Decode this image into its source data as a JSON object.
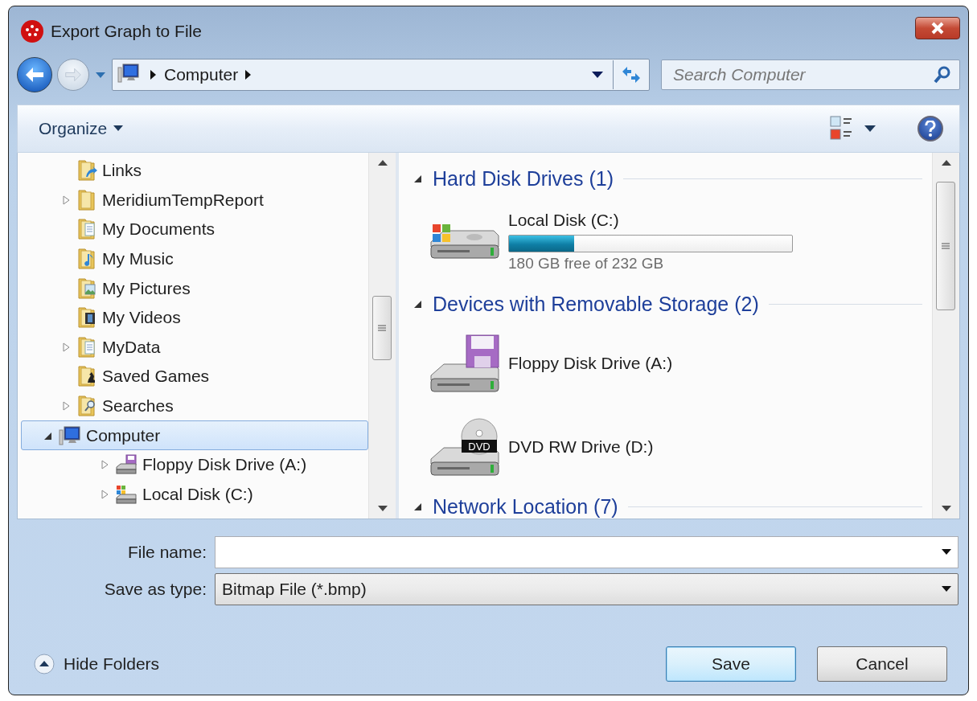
{
  "window": {
    "title": "Export Graph to File"
  },
  "address": {
    "crumbs": [
      "Computer"
    ]
  },
  "search": {
    "placeholder": "Search Computer"
  },
  "toolbar": {
    "organize": "Organize"
  },
  "tree": [
    {
      "kind": "links",
      "label": "Links",
      "has_children": false,
      "selected": false
    },
    {
      "kind": "folder",
      "label": "MeridiumTempReport",
      "has_children": true,
      "expanded": false,
      "selected": false
    },
    {
      "kind": "documents",
      "label": "My Documents",
      "has_children": false,
      "selected": false
    },
    {
      "kind": "music",
      "label": "My Music",
      "has_children": false,
      "selected": false
    },
    {
      "kind": "pictures",
      "label": "My Pictures",
      "has_children": false,
      "selected": false
    },
    {
      "kind": "videos",
      "label": "My Videos",
      "has_children": false,
      "selected": false
    },
    {
      "kind": "documents",
      "label": "MyData",
      "has_children": true,
      "expanded": false,
      "selected": false
    },
    {
      "kind": "games",
      "label": "Saved Games",
      "has_children": false,
      "selected": false
    },
    {
      "kind": "searches",
      "label": "Searches",
      "has_children": true,
      "expanded": false,
      "selected": false
    },
    {
      "kind": "computer",
      "label": "Computer",
      "has_children": true,
      "expanded": true,
      "selected": true,
      "children": [
        {
          "kind": "floppy",
          "label": "Floppy Disk Drive (A:)",
          "has_children": true,
          "expanded": false,
          "selected": false
        },
        {
          "kind": "hard-disk",
          "label": "Local Disk (C:)",
          "has_children": true,
          "expanded": false,
          "selected": false
        }
      ]
    }
  ],
  "groups": [
    {
      "title": "Hard Disk Drives (1)",
      "items": [
        {
          "kind": "hard-disk",
          "name": "Local Disk (C:)",
          "level": 0.23,
          "space": "180 GB free of 232 GB"
        }
      ]
    },
    {
      "title": "Devices with Removable Storage (2)",
      "items": [
        {
          "kind": "floppy",
          "name": "Floppy Disk Drive (A:)"
        },
        {
          "kind": "dvd",
          "name": "DVD RW Drive (D:)",
          "badge": "DVD"
        }
      ]
    },
    {
      "title": "Network Location (7)"
    }
  ],
  "form": {
    "file_name_label": "File name:",
    "type_label": "Save as type:",
    "type_value": "Bitmap File (*.bmp)"
  },
  "hide_folders": "Hide Folders",
  "buttons": [
    {
      "label": "Save",
      "default": true
    },
    {
      "label": "Cancel",
      "default": false
    }
  ]
}
